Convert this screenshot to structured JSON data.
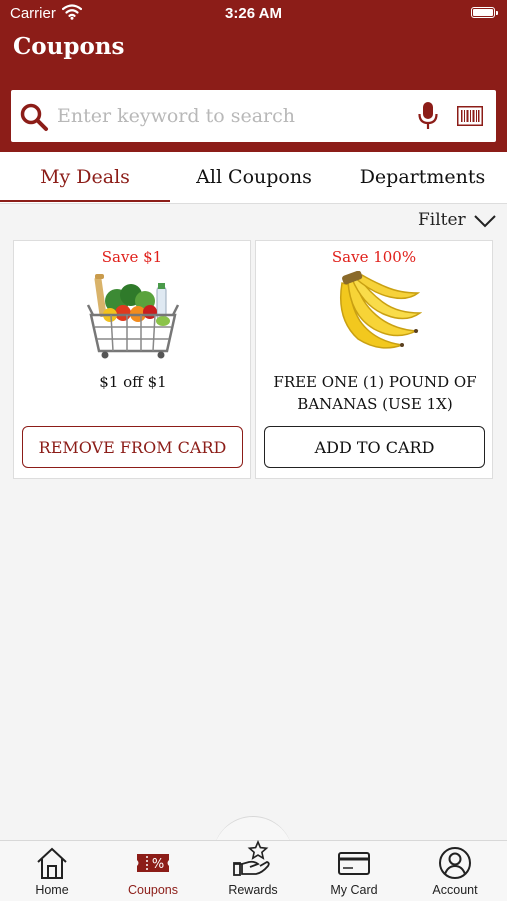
{
  "status_bar": {
    "carrier": "Carrier",
    "time": "3:26 AM"
  },
  "header": {
    "title": "Coupons"
  },
  "search": {
    "placeholder": "Enter keyword to search"
  },
  "tabs": [
    {
      "label": "My Deals",
      "active": true
    },
    {
      "label": "All Coupons",
      "active": false
    },
    {
      "label": "Departments",
      "active": false
    }
  ],
  "filter": {
    "label": "Filter"
  },
  "coupons": [
    {
      "save_label": "Save $1",
      "description": "$1 off $1",
      "image": "grocery-basket",
      "button_label": "REMOVE FROM CARD",
      "button_state": "added"
    },
    {
      "save_label": "Save 100%",
      "description": "FREE ONE (1) POUND OF BANANAS (USE 1X)",
      "image": "bananas",
      "button_label": "ADD TO CARD",
      "button_state": "not-added"
    }
  ],
  "nav": [
    {
      "label": "Home",
      "icon": "home-icon",
      "active": false
    },
    {
      "label": "Coupons",
      "icon": "coupon-icon",
      "active": true
    },
    {
      "label": "Rewards",
      "icon": "rewards-icon",
      "active": false
    },
    {
      "label": "My Card",
      "icon": "card-icon",
      "active": false
    },
    {
      "label": "Account",
      "icon": "account-icon",
      "active": false
    }
  ],
  "colors": {
    "brand": "#8c1d18",
    "save": "#e0201b",
    "background": "#f4f4f4"
  }
}
